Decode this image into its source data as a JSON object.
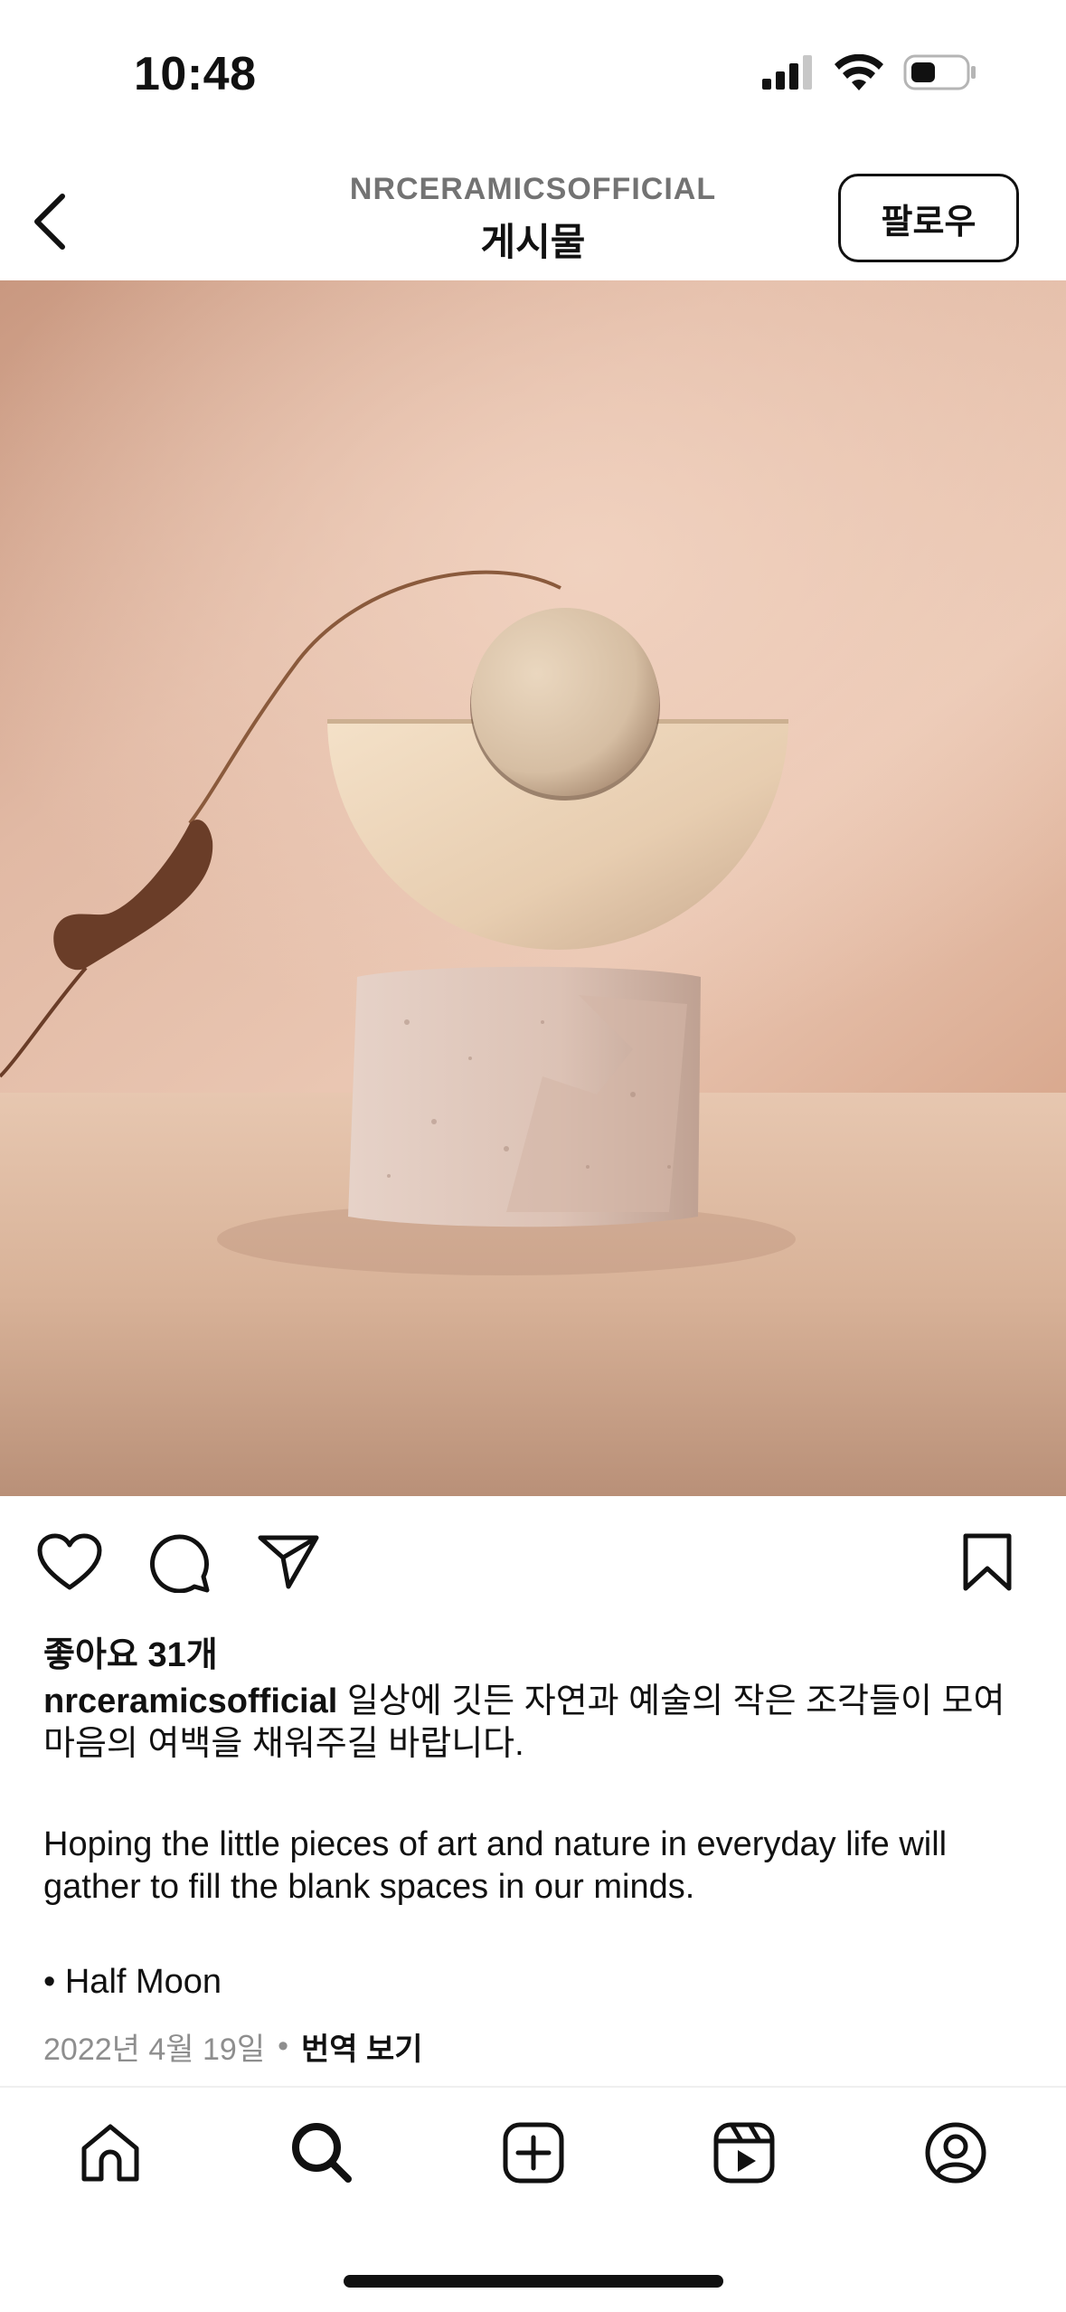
{
  "status_bar": {
    "time": "10:48",
    "icons": [
      "cellular-signal-icon",
      "wifi-icon",
      "battery-icon"
    ]
  },
  "header": {
    "account_name": "NRCERAMICSOFFICIAL",
    "title": "게시물",
    "follow_label": "팔로우",
    "back_icon": "chevron-left-icon"
  },
  "post": {
    "image_description_icon": "ceramic-half-moon-sculpture-photo",
    "actions": [
      "heart-icon",
      "comment-icon",
      "share-icon",
      "bookmark-icon"
    ],
    "likes": "좋아요 31개",
    "username": "nrceramicsofficial",
    "caption_ko": "일상에 깃든 자연과 예술의 작은 조각들이 모여 마음의 여백을 채워주길 바랍니다.",
    "caption_en": "Hoping the little pieces of art and nature in everyday life will gather to fill the blank spaces in our minds.",
    "caption_bullet": "• Half Moon",
    "date": "2022년 4월 19일",
    "dot": "•",
    "translate_label": "번역 보기"
  },
  "bottom_nav": [
    "home-icon",
    "search-icon",
    "create-icon",
    "reels-icon",
    "profile-icon"
  ],
  "colors": {
    "text_primary": "#111111",
    "text_secondary": "#8e8e8e",
    "photo_background": "#d9ad96"
  }
}
